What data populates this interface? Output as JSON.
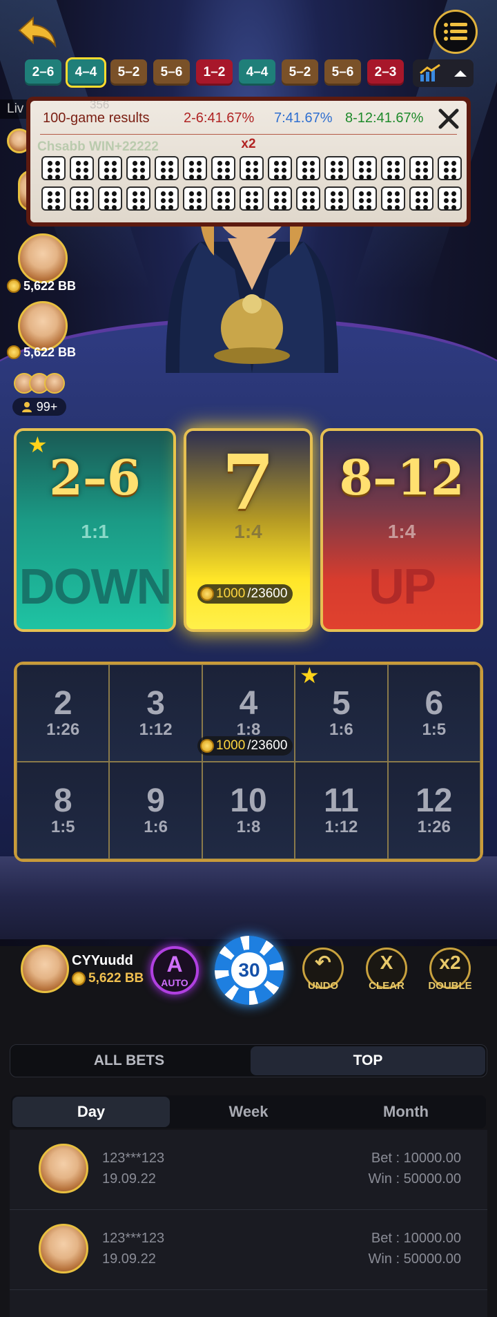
{
  "history": [
    "2–6",
    "4–4",
    "5–2",
    "5–6",
    "1–2",
    "4–4",
    "5–2",
    "5–6",
    "2–3"
  ],
  "history_colors": [
    "teal",
    "teal",
    "brown",
    "brown",
    "red",
    "teal",
    "brown",
    "brown",
    "red"
  ],
  "history_selected_index": 1,
  "live_label": "Liv",
  "popup": {
    "title": "100-game results",
    "stat_down": "2-6:41.67%",
    "stat_seven": "7:41.67%",
    "stat_up": "8-12:41.67%",
    "multiplier": "x2",
    "ghost_text": "Chsabb  WIN+22222",
    "ghost_num": "356",
    "colors": {
      "down": "#b02424",
      "seven": "#2f6fd0",
      "up": "#1e8a2a"
    }
  },
  "players": [
    {
      "balance": "5,622 BB"
    },
    {
      "balance": "5,622 BB"
    }
  ],
  "crowd_count": "99+",
  "bets": {
    "down": {
      "range": "2–6",
      "odds": "1:1",
      "word": "DOWN"
    },
    "seven": {
      "range": "7",
      "odds": "1:4",
      "bet_current": "1000",
      "bet_total": "/23600"
    },
    "up": {
      "range": "8–12",
      "odds": "1:4",
      "word": "UP"
    }
  },
  "numbers": [
    {
      "n": "2",
      "o": "1:26"
    },
    {
      "n": "3",
      "o": "1:12"
    },
    {
      "n": "4",
      "o": "1:8"
    },
    {
      "n": "5",
      "o": "1:6"
    },
    {
      "n": "6",
      "o": "1:5"
    },
    {
      "n": "8",
      "o": "1:5"
    },
    {
      "n": "9",
      "o": "1:6"
    },
    {
      "n": "10",
      "o": "1:8"
    },
    {
      "n": "11",
      "o": "1:12"
    },
    {
      "n": "12",
      "o": "1:26"
    }
  ],
  "number_bet": {
    "current": "1000",
    "total": "/23600"
  },
  "me": {
    "name": "CYYuudd",
    "balance": "5,622 BB"
  },
  "auto": {
    "letter": "A",
    "label": "AUTO"
  },
  "chip_value": "30",
  "controls": {
    "undo": {
      "glyph": "↶",
      "label": "UNDO"
    },
    "clear": {
      "glyph": "X",
      "label": "CLEAR"
    },
    "double": {
      "glyph": "x2",
      "label": "DOUBLE"
    }
  },
  "tabs": {
    "all": "ALL BETS",
    "top": "TOP",
    "active": "top"
  },
  "subtabs": {
    "day": "Day",
    "week": "Week",
    "month": "Month",
    "active": "day"
  },
  "leaderboard": [
    {
      "name": "123***123",
      "date": "19.09.22",
      "bet": "Bet : 10000.00",
      "win": "Win : 50000.00"
    },
    {
      "name": "123***123",
      "date": "19.09.22",
      "bet": "Bet : 10000.00",
      "win": "Win : 50000.00"
    }
  ]
}
